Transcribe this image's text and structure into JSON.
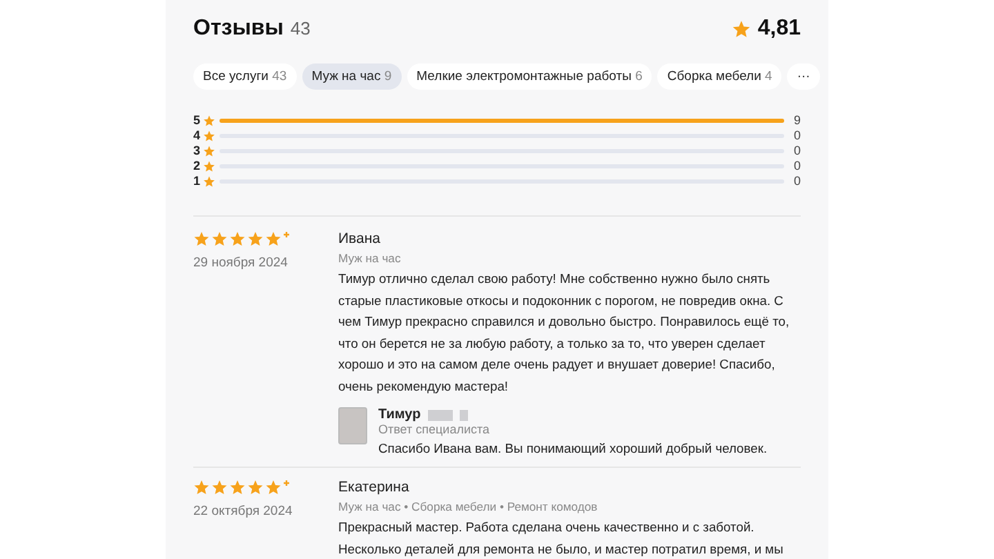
{
  "header": {
    "title": "Отзывы",
    "count": "43",
    "rating": "4,81"
  },
  "filters": [
    {
      "label": "Все услуги",
      "count": "43",
      "selected": false
    },
    {
      "label": "Муж на час",
      "count": "9",
      "selected": true
    },
    {
      "label": "Мелкие электромонтажные работы",
      "count": "6",
      "selected": false
    },
    {
      "label": "Сборка мебели",
      "count": "4",
      "selected": false
    }
  ],
  "more_button": "···",
  "distribution": [
    {
      "stars_label": "5",
      "level": 1,
      "count": "9"
    },
    {
      "stars_label": "4",
      "level": 0,
      "count": "0"
    },
    {
      "stars_label": "3",
      "level": 0,
      "count": "0"
    },
    {
      "stars_label": "2",
      "level": 0,
      "count": "0"
    },
    {
      "stars_label": "1",
      "level": 0,
      "count": "0"
    }
  ],
  "reviews": [
    {
      "stars": 5,
      "date": "29 ноября 2024",
      "author": "Ивана",
      "services": "Муж на час",
      "text": "Тимур отлично сделал свою работу! Мне собственно нужно было снять старые пластиковые откосы и подоконник с порогом, не повредив окна. С чем Тимур прекрасно справился и довольно быстро. Понравилось ещё то, что он берется не за любую работу, а только за то, что уверен сделает хорошо и это на самом деле очень радует и внушает доверие! Спасибо, очень рекомендую мастера!",
      "reply": {
        "name": "Тимур",
        "role": "Ответ специалиста",
        "text": "Спасибо Ивана вам. Вы понимающий хороший добрый человек."
      }
    },
    {
      "stars": 5,
      "date": "22 октября 2024",
      "author": "Екатерина",
      "services": "Муж на час • Сборка мебели • Ремонт комодов",
      "text": "Прекрасный мастер. Работа сделана очень качественно и с заботой. Несколько деталей для ремонта не было, и мастер потратил время, и мы"
    }
  ]
}
